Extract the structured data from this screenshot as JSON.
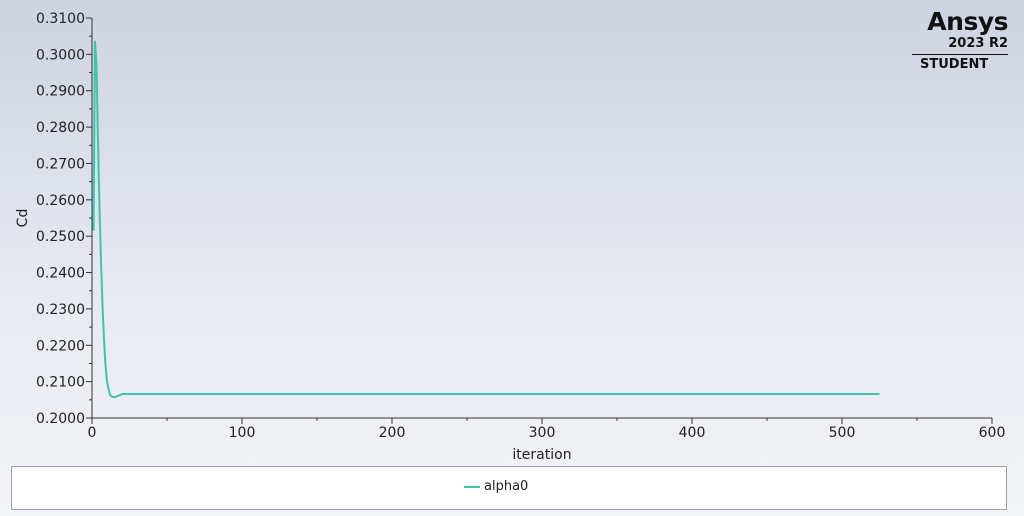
{
  "branding": {
    "name": "Ansys",
    "version": "2023 R2",
    "edition": "STUDENT"
  },
  "chart_data": {
    "type": "line",
    "title": "",
    "xlabel": "iteration",
    "ylabel": "Cd",
    "xlim": [
      0,
      600
    ],
    "ylim": [
      0.2,
      0.31
    ],
    "x_ticks": [
      0,
      100,
      200,
      300,
      400,
      500,
      600
    ],
    "y_ticks": [
      0.2,
      0.21,
      0.22,
      0.23,
      0.24,
      0.25,
      0.26,
      0.27,
      0.28,
      0.29,
      0.3,
      0.31
    ],
    "y_tick_labels": [
      "0.2000",
      "0.2100",
      "0.2200",
      "0.2300",
      "0.2400",
      "0.2500",
      "0.2600",
      "0.2700",
      "0.2800",
      "0.2900",
      "0.3000",
      "0.3100"
    ],
    "x_tick_labels": [
      "0",
      "100",
      "200",
      "300",
      "400",
      "500",
      "600"
    ],
    "grid": false,
    "legend_position": "bottom",
    "series": [
      {
        "name": "alpha0",
        "color": "#3cc6ae",
        "x": [
          1,
          2,
          3,
          4,
          5,
          6,
          7,
          8,
          9,
          10,
          11,
          12,
          13,
          15,
          18,
          20,
          25,
          30,
          50,
          100,
          200,
          300,
          400,
          500,
          525
        ],
        "y": [
          0.2515,
          0.3035,
          0.297,
          0.276,
          0.258,
          0.243,
          0.231,
          0.2215,
          0.2145,
          0.21,
          0.208,
          0.2065,
          0.2059,
          0.2057,
          0.2062,
          0.2066,
          0.2066,
          0.2066,
          0.2066,
          0.2066,
          0.2066,
          0.2066,
          0.2066,
          0.2066,
          0.2066
        ]
      }
    ]
  }
}
